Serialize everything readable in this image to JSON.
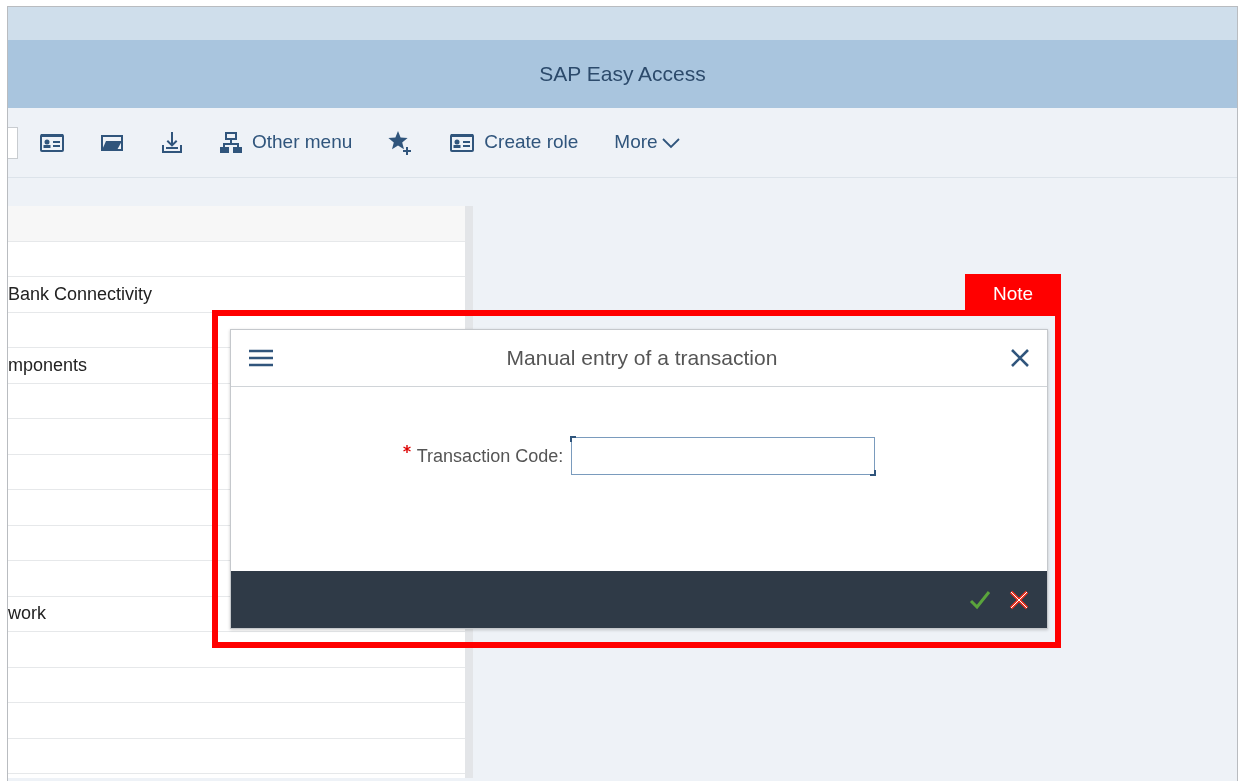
{
  "window": {
    "title": "SAP Easy Access"
  },
  "toolbar": [
    {
      "kind": "dropdown-edge"
    },
    {
      "kind": "icon"
    },
    {
      "kind": "icon"
    },
    {
      "kind": "icon"
    },
    {
      "kind": "button",
      "label": "Other menu"
    },
    {
      "kind": "icon"
    },
    {
      "kind": "button",
      "label": "Create role"
    },
    {
      "kind": "menu",
      "label": "More"
    }
  ],
  "tree": {
    "rows": [
      {
        "kind": "blank"
      },
      {
        "kind": "text",
        "label": "Bank Connectivity"
      },
      {
        "kind": "blank"
      },
      {
        "kind": "text",
        "label": "mponents"
      },
      {
        "kind": "blank"
      },
      {
        "kind": "blank"
      },
      {
        "kind": "blank"
      },
      {
        "kind": "blank"
      },
      {
        "kind": "blank"
      },
      {
        "kind": "blank"
      },
      {
        "kind": "text",
        "label": "work"
      },
      {
        "kind": "blank"
      },
      {
        "kind": "blank"
      },
      {
        "kind": "blank"
      },
      {
        "kind": "blank"
      }
    ]
  },
  "note": {
    "label": "Note"
  },
  "dialog": {
    "title": "Manual entry of a transaction",
    "field": {
      "label": "Transaction Code:",
      "required": true
    },
    "footer_buttons": [
      {
        "kind": "confirm"
      },
      {
        "kind": "cancel"
      }
    ]
  }
}
